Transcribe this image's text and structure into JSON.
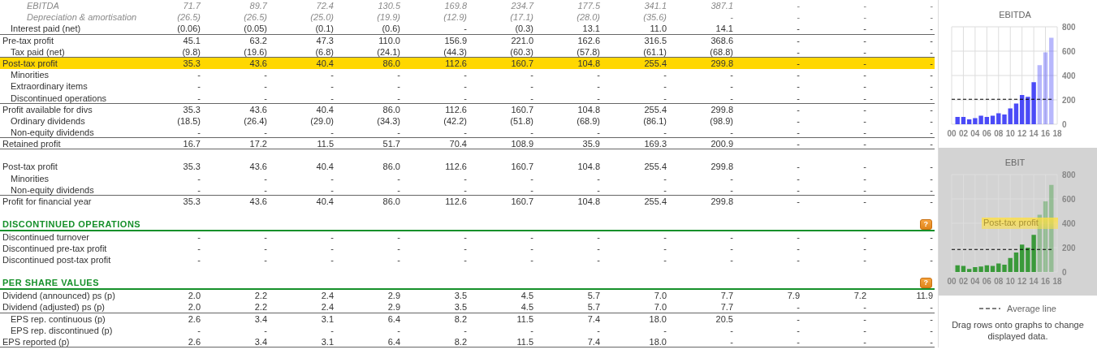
{
  "table": {
    "rows": [
      {
        "kind": "memo",
        "label": "EBITDA",
        "rule_below": false,
        "selected": false,
        "values": [
          "71.7",
          "89.7",
          "72.4",
          "130.5",
          "169.8",
          "234.7",
          "177.5",
          "341.1",
          "387.1",
          "-",
          "-",
          "-"
        ]
      },
      {
        "kind": "memo",
        "label": "Depreciation & amortisation",
        "rule_below": false,
        "selected": false,
        "values": [
          "(26.5)",
          "(26.5)",
          "(25.0)",
          "(19.9)",
          "(12.9)",
          "(17.1)",
          "(28.0)",
          "(35.6)",
          "-",
          "-",
          "-",
          "-"
        ]
      },
      {
        "kind": "line",
        "label": "Interest paid (net)",
        "indent": true,
        "rule_below": true,
        "selected": false,
        "values": [
          "(0.06)",
          "(0.05)",
          "(0.1)",
          "(0.6)",
          "-",
          "(0.3)",
          "13.1",
          "11.0",
          "14.1",
          "-",
          "-",
          "-"
        ]
      },
      {
        "kind": "line",
        "label": "Pre-tax profit",
        "indent": false,
        "rule_below": false,
        "selected": false,
        "values": [
          "45.1",
          "63.2",
          "47.3",
          "110.0",
          "156.9",
          "221.0",
          "162.6",
          "316.5",
          "368.6",
          "-",
          "-",
          "-"
        ]
      },
      {
        "kind": "line",
        "label": "Tax paid (net)",
        "indent": true,
        "rule_below": true,
        "selected": false,
        "values": [
          "(9.8)",
          "(19.6)",
          "(6.8)",
          "(24.1)",
          "(44.3)",
          "(60.3)",
          "(57.8)",
          "(61.1)",
          "(68.8)",
          "-",
          "-",
          "-"
        ]
      },
      {
        "kind": "line",
        "label": "Post-tax profit",
        "indent": false,
        "rule_below": false,
        "selected": true,
        "values": [
          "35.3",
          "43.6",
          "40.4",
          "86.0",
          "112.6",
          "160.7",
          "104.8",
          "255.4",
          "299.8",
          "-",
          "-",
          "-"
        ]
      },
      {
        "kind": "line",
        "label": "Minorities",
        "indent": true,
        "rule_below": false,
        "selected": false,
        "values": [
          "-",
          "-",
          "-",
          "-",
          "-",
          "-",
          "-",
          "-",
          "-",
          "-",
          "-",
          "-"
        ]
      },
      {
        "kind": "line",
        "label": "Extraordinary items",
        "indent": true,
        "rule_below": false,
        "selected": false,
        "values": [
          "-",
          "-",
          "-",
          "-",
          "-",
          "-",
          "-",
          "-",
          "-",
          "-",
          "-",
          "-"
        ]
      },
      {
        "kind": "line",
        "label": "Discontinued operations",
        "indent": true,
        "rule_below": true,
        "selected": false,
        "values": [
          "-",
          "-",
          "-",
          "-",
          "-",
          "-",
          "-",
          "-",
          "-",
          "-",
          "-",
          "-"
        ]
      },
      {
        "kind": "line",
        "label": "Profit available for divs",
        "indent": false,
        "rule_below": false,
        "selected": false,
        "values": [
          "35.3",
          "43.6",
          "40.4",
          "86.0",
          "112.6",
          "160.7",
          "104.8",
          "255.4",
          "299.8",
          "-",
          "-",
          "-"
        ]
      },
      {
        "kind": "line",
        "label": "Ordinary dividends",
        "indent": true,
        "rule_below": false,
        "selected": false,
        "values": [
          "(18.5)",
          "(26.4)",
          "(29.0)",
          "(34.3)",
          "(42.2)",
          "(51.8)",
          "(68.9)",
          "(86.1)",
          "(98.9)",
          "-",
          "-",
          "-"
        ]
      },
      {
        "kind": "line",
        "label": "Non-equity dividends",
        "indent": true,
        "rule_below": true,
        "selected": false,
        "values": [
          "-",
          "-",
          "-",
          "-",
          "-",
          "-",
          "-",
          "-",
          "-",
          "-",
          "-",
          "-"
        ]
      },
      {
        "kind": "line",
        "label": "Retained profit",
        "indent": false,
        "rule_below": true,
        "selected": false,
        "values": [
          "16.7",
          "17.2",
          "11.5",
          "51.7",
          "70.4",
          "108.9",
          "35.9",
          "169.3",
          "200.9",
          "-",
          "-",
          "-"
        ]
      },
      {
        "kind": "line",
        "label": "Post-tax profit",
        "indent": false,
        "rule_below": false,
        "selected": false,
        "space_before": true,
        "values": [
          "35.3",
          "43.6",
          "40.4",
          "86.0",
          "112.6",
          "160.7",
          "104.8",
          "255.4",
          "299.8",
          "-",
          "-",
          "-"
        ]
      },
      {
        "kind": "line",
        "label": "Minorities",
        "indent": true,
        "rule_below": false,
        "selected": false,
        "values": [
          "-",
          "-",
          "-",
          "-",
          "-",
          "-",
          "-",
          "-",
          "-",
          "-",
          "-",
          "-"
        ]
      },
      {
        "kind": "line",
        "label": "Non-equity dividends",
        "indent": true,
        "rule_below": true,
        "selected": false,
        "values": [
          "-",
          "-",
          "-",
          "-",
          "-",
          "-",
          "-",
          "-",
          "-",
          "-",
          "-",
          "-"
        ]
      },
      {
        "kind": "line",
        "label": "Profit for financial year",
        "indent": false,
        "rule_below": false,
        "selected": false,
        "values": [
          "35.3",
          "43.6",
          "40.4",
          "86.0",
          "112.6",
          "160.7",
          "104.8",
          "255.4",
          "299.8",
          "-",
          "-",
          "-"
        ]
      },
      {
        "kind": "heading",
        "label": "DISCONTINUED OPERATIONS",
        "help": "?",
        "space_before": true
      },
      {
        "kind": "line",
        "label": "Discontinued turnover",
        "indent": false,
        "rule_below": false,
        "selected": false,
        "values": [
          "-",
          "-",
          "-",
          "-",
          "-",
          "-",
          "-",
          "-",
          "-",
          "-",
          "-",
          "-"
        ]
      },
      {
        "kind": "line",
        "label": "Discontinued pre-tax profit",
        "indent": false,
        "rule_below": false,
        "selected": false,
        "values": [
          "-",
          "-",
          "-",
          "-",
          "-",
          "-",
          "-",
          "-",
          "-",
          "-",
          "-",
          "-"
        ]
      },
      {
        "kind": "line",
        "label": "Discontinued post-tax profit",
        "indent": false,
        "rule_below": false,
        "selected": false,
        "values": [
          "-",
          "-",
          "-",
          "-",
          "-",
          "-",
          "-",
          "-",
          "-",
          "-",
          "-",
          "-"
        ]
      },
      {
        "kind": "heading",
        "label": "PER SHARE VALUES",
        "help": "?",
        "space_before": true
      },
      {
        "kind": "line",
        "label": "Dividend (announced) ps (p)",
        "indent": false,
        "rule_below": false,
        "selected": false,
        "values": [
          "2.0",
          "2.2",
          "2.4",
          "2.9",
          "3.5",
          "4.5",
          "5.7",
          "7.0",
          "7.7",
          "7.9",
          "7.2",
          "11.9"
        ]
      },
      {
        "kind": "line",
        "label": "Dividend (adjusted) ps (p)",
        "indent": false,
        "rule_below": true,
        "selected": false,
        "values": [
          "2.0",
          "2.2",
          "2.4",
          "2.9",
          "3.5",
          "4.5",
          "5.7",
          "7.0",
          "7.7",
          "-",
          "-",
          "-"
        ]
      },
      {
        "kind": "line",
        "label": "EPS rep. continuous (p)",
        "indent": true,
        "rule_below": false,
        "selected": false,
        "values": [
          "2.6",
          "3.4",
          "3.1",
          "6.4",
          "8.2",
          "11.5",
          "7.4",
          "18.0",
          "20.5",
          "-",
          "-",
          "-"
        ]
      },
      {
        "kind": "line",
        "label": "EPS rep. discontinued (p)",
        "indent": true,
        "rule_below": false,
        "selected": false,
        "values": [
          "-",
          "-",
          "-",
          "-",
          "-",
          "-",
          "-",
          "-",
          "-",
          "-",
          "-",
          "-"
        ]
      },
      {
        "kind": "line",
        "label": "EPS reported (p)",
        "indent": false,
        "rule_below": true,
        "selected": false,
        "values": [
          "2.6",
          "3.4",
          "3.1",
          "6.4",
          "8.2",
          "11.5",
          "7.4",
          "18.0",
          "-",
          "-",
          "-",
          "-"
        ]
      }
    ]
  },
  "charts": [
    {
      "drop_target": false,
      "forecast_bars": [
        false,
        false,
        false,
        false,
        false,
        false,
        false,
        false,
        false,
        false,
        false,
        false,
        false,
        false,
        true,
        true,
        true
      ],
      "chart_data": {
        "type": "bar",
        "title": "EBITDA",
        "grid": true,
        "x": [
          1,
          2,
          3,
          4,
          5,
          6,
          7,
          8,
          9,
          10,
          11,
          12,
          13,
          14,
          15,
          16,
          17
        ],
        "xlim": [
          0,
          18
        ],
        "ylim": [
          0,
          800
        ],
        "xticks": [
          {
            "value": 0,
            "label": "00"
          },
          {
            "value": 2,
            "label": "02"
          },
          {
            "value": 4,
            "label": "04"
          },
          {
            "value": 6,
            "label": "06"
          },
          {
            "value": 8,
            "label": "08"
          },
          {
            "value": 10,
            "label": "10"
          },
          {
            "value": 12,
            "label": "12"
          },
          {
            "value": 14,
            "label": "14"
          },
          {
            "value": 16,
            "label": "16"
          },
          {
            "value": 18,
            "label": "18"
          }
        ],
        "yticks": [
          0,
          200,
          400,
          600,
          800
        ],
        "series": [
          {
            "color": "#4b4bf7",
            "values": [
              60,
              60,
              40,
              50,
              70,
              60,
              70,
              90,
              80,
              130,
              170,
              240,
              225,
              345,
              485,
              590,
              710
            ]
          }
        ],
        "ref_lines": [
          {
            "axis": "y",
            "value": 205
          }
        ]
      }
    },
    {
      "drop_target": true,
      "forecast_bars": [
        false,
        false,
        false,
        false,
        false,
        false,
        false,
        false,
        false,
        false,
        false,
        false,
        false,
        false,
        true,
        true,
        true
      ],
      "drag_ghost": "Post-tax profit",
      "chart_data": {
        "type": "bar",
        "title": "EBIT",
        "grid": true,
        "x": [
          1,
          2,
          3,
          4,
          5,
          6,
          7,
          8,
          9,
          10,
          11,
          12,
          13,
          14,
          15,
          16,
          17
        ],
        "xlim": [
          0,
          18
        ],
        "ylim": [
          0,
          800
        ],
        "xticks": [
          {
            "value": 0,
            "label": "00"
          },
          {
            "value": 2,
            "label": "02"
          },
          {
            "value": 4,
            "label": "04"
          },
          {
            "value": 6,
            "label": "06"
          },
          {
            "value": 8,
            "label": "08"
          },
          {
            "value": 10,
            "label": "10"
          },
          {
            "value": 12,
            "label": "12"
          },
          {
            "value": 14,
            "label": "14"
          },
          {
            "value": 16,
            "label": "16"
          },
          {
            "value": 18,
            "label": "18"
          }
        ],
        "yticks": [
          0,
          200,
          400,
          600,
          800
        ],
        "series": [
          {
            "color": "#3a9a3a",
            "values": [
              55,
              50,
              25,
              40,
              45,
              55,
              50,
              70,
              60,
              115,
              160,
              225,
              200,
              305,
              470,
              580,
              715
            ]
          }
        ],
        "ref_lines": [
          {
            "axis": "y",
            "value": 185
          }
        ]
      }
    }
  ],
  "legend": {
    "average_label": "Average line",
    "note": "Drag rows onto graphs to change displayed data."
  }
}
